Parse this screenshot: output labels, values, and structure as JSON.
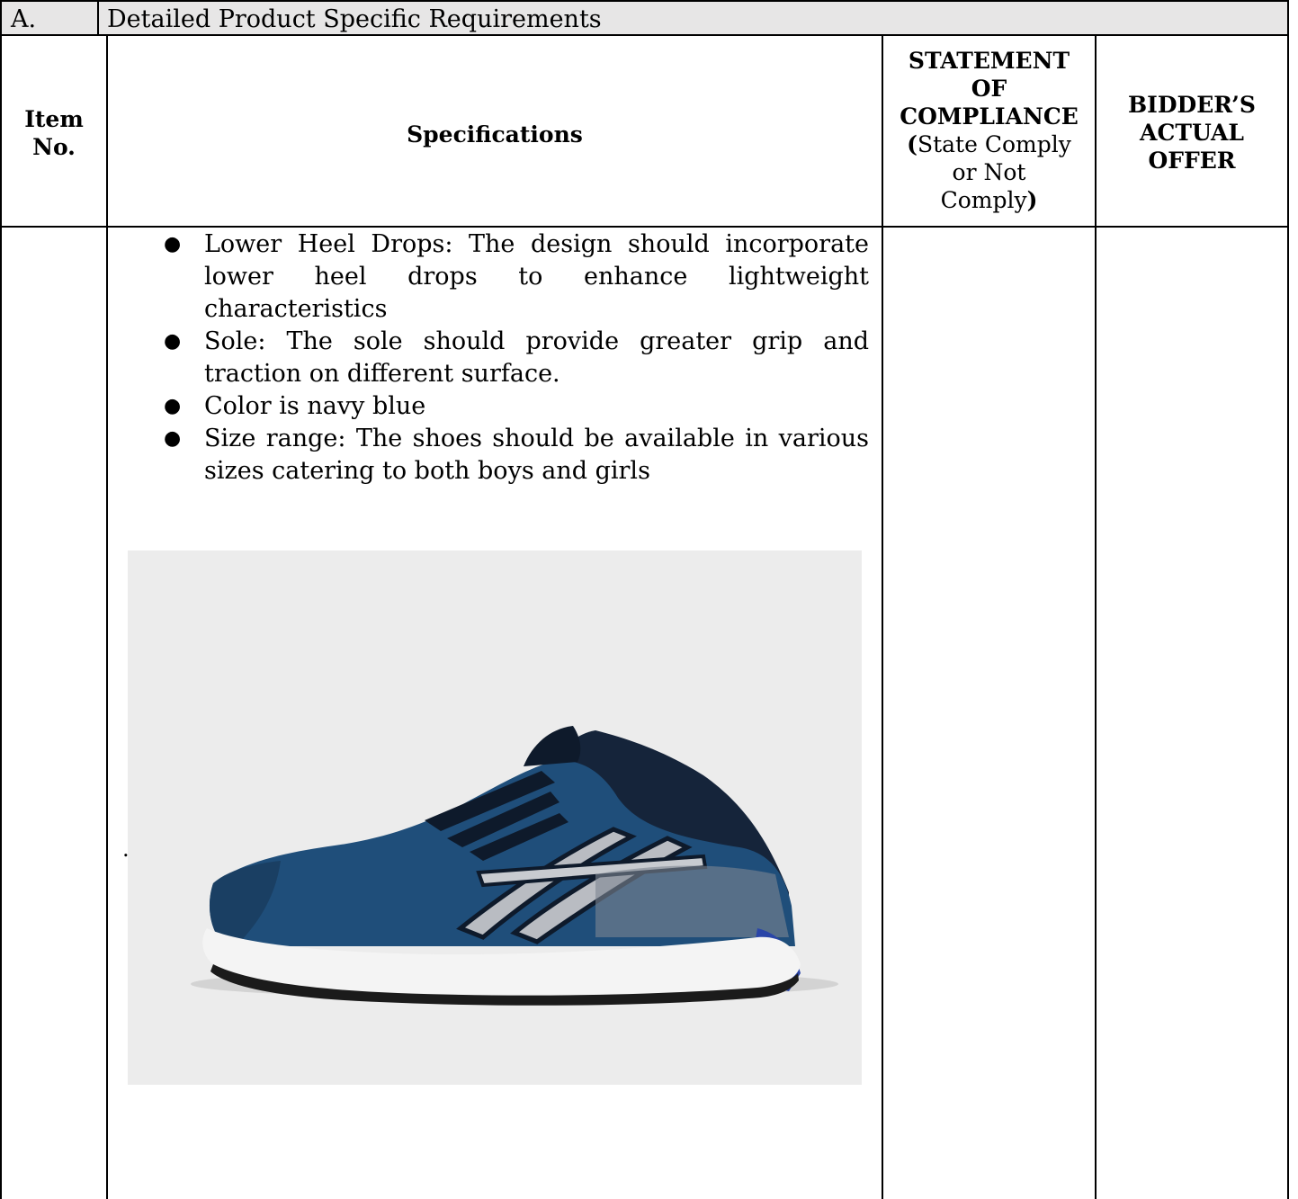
{
  "section": {
    "letter": "A.",
    "title": "Detailed Product Specific Requirements"
  },
  "table": {
    "headers": {
      "item_no_line1": "Item",
      "item_no_line2": "No.",
      "specifications": "Specifications",
      "statement_line1": "STATEMENT",
      "statement_line2": "OF",
      "statement_line3": "COMPLIANCE",
      "statement_paren_open": "(",
      "statement_note_line1": "State Comply",
      "statement_note_line2": "or Not",
      "statement_note_line3": "Comply",
      "statement_paren_close": ")",
      "bidder_line1": "BIDDER’S",
      "bidder_line2": "ACTUAL",
      "bidder_line3": "OFFER"
    },
    "specifications": [
      "Lower Heel Drops: The design should incorporate lower heel drops to enhance lightweight characteristics",
      "Sole: The sole should provide greater grip and traction on different surface.",
      "Color is navy blue",
      "Size range: The shoes should be available in various sizes catering to both boys and girls"
    ],
    "stray_mark": "."
  },
  "image": {
    "icon": "navy-blue-running-shoe",
    "colors": {
      "upper": "#1f4e7a",
      "sole": "#f4f4f4",
      "background": "#ececec"
    }
  }
}
